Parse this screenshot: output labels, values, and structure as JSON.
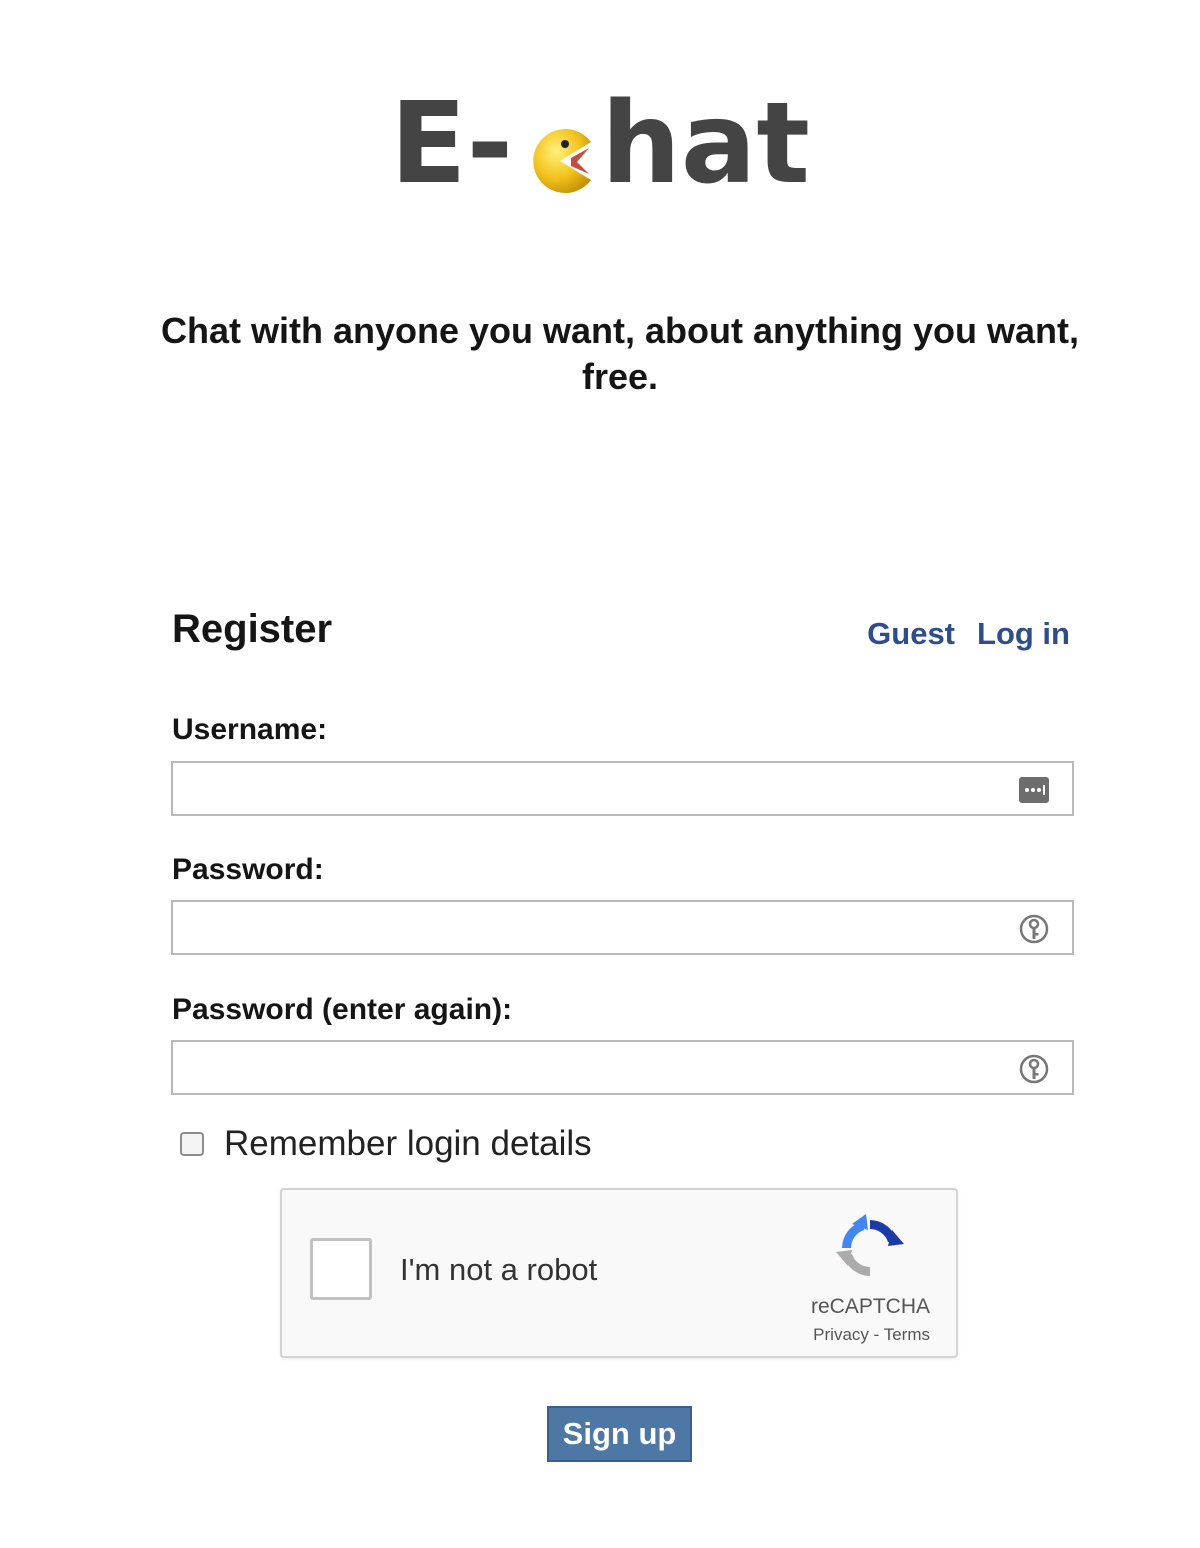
{
  "logo": {
    "text_left": "E-",
    "text_right": "hat"
  },
  "tagline": "Chat with anyone you want, about anything you want, free.",
  "register": {
    "title": "Register",
    "links": {
      "guest": "Guest",
      "login": "Log in"
    }
  },
  "form": {
    "username_label": "Username:",
    "username_value": "",
    "password_label": "Password:",
    "password_value": "",
    "password_again_label": "Password (enter again):",
    "password_again_value": "",
    "remember_label": "Remember login details",
    "remember_checked": false
  },
  "captcha": {
    "label": "I'm not a robot",
    "brand": "reCAPTCHA",
    "privacy": "Privacy",
    "separator": " - ",
    "terms": "Terms",
    "checked": false
  },
  "signup_label": "Sign up",
  "colors": {
    "link": "#2e4d8f",
    "button": "#4d77a5",
    "logo_text": "#444444",
    "pacman": "#f2c21b"
  },
  "icons": {
    "username_field": "password-manager-icon",
    "password_field": "password-key-icon",
    "password_again_field": "password-key-icon",
    "logo_letter": "pacman-icon",
    "captcha_logo": "recaptcha-logo-icon"
  }
}
